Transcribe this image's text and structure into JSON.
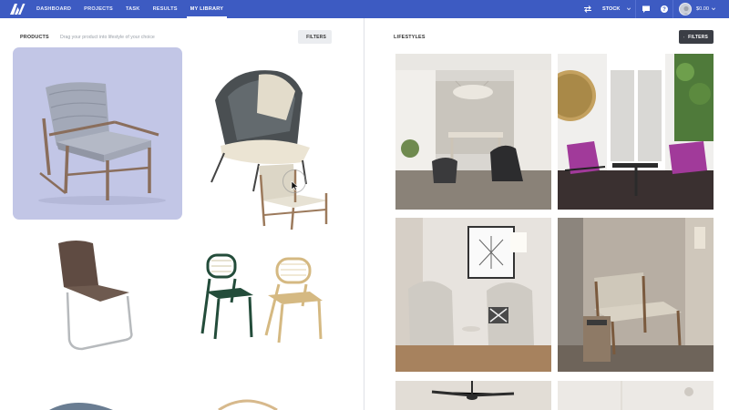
{
  "nav": {
    "logo": "AV",
    "items": [
      {
        "label": "DASHBOARD"
      },
      {
        "label": "PROJECTS"
      },
      {
        "label": "TASK"
      },
      {
        "label": "RESULTS"
      },
      {
        "label": "MY LIBRARY"
      }
    ],
    "active_index": 4,
    "stock_label": "STOCK",
    "balance": "$0.00",
    "colors": {
      "bar": "#3d5bc2",
      "bar_text": "#ffffff"
    }
  },
  "products": {
    "title": "PRODUCTS",
    "hint": "Drag your product into lifestyle of your choice",
    "filters_label": "FILTERS",
    "items": [
      {
        "name": "grey-cushion-lounge-chair",
        "selected": true
      },
      {
        "name": "woven-rope-lounge-chair",
        "selected": false
      },
      {
        "name": "leather-cantilever-chair",
        "selected": false
      },
      {
        "name": "cane-back-chairs-pair",
        "selected": false
      },
      {
        "name": "blue-chair-partial",
        "selected": false
      },
      {
        "name": "bentwood-chair-partial",
        "selected": false
      }
    ],
    "selected_color": "#c2c6e6"
  },
  "lifestyles": {
    "title": "LIFESTYLES",
    "filters_label": "FILTERS",
    "items": [
      {
        "name": "dining-room-scene"
      },
      {
        "name": "purple-chairs-scene"
      },
      {
        "name": "grey-armchairs-scene"
      },
      {
        "name": "concrete-wall-chair-scene"
      },
      {
        "name": "ceiling-fan-scene"
      },
      {
        "name": "ceiling-scene"
      }
    ]
  },
  "icons": [
    "logo-icon",
    "swap-icon",
    "chevron-down-icon",
    "chat-icon",
    "help-icon",
    "avatar",
    "filter-icon"
  ]
}
